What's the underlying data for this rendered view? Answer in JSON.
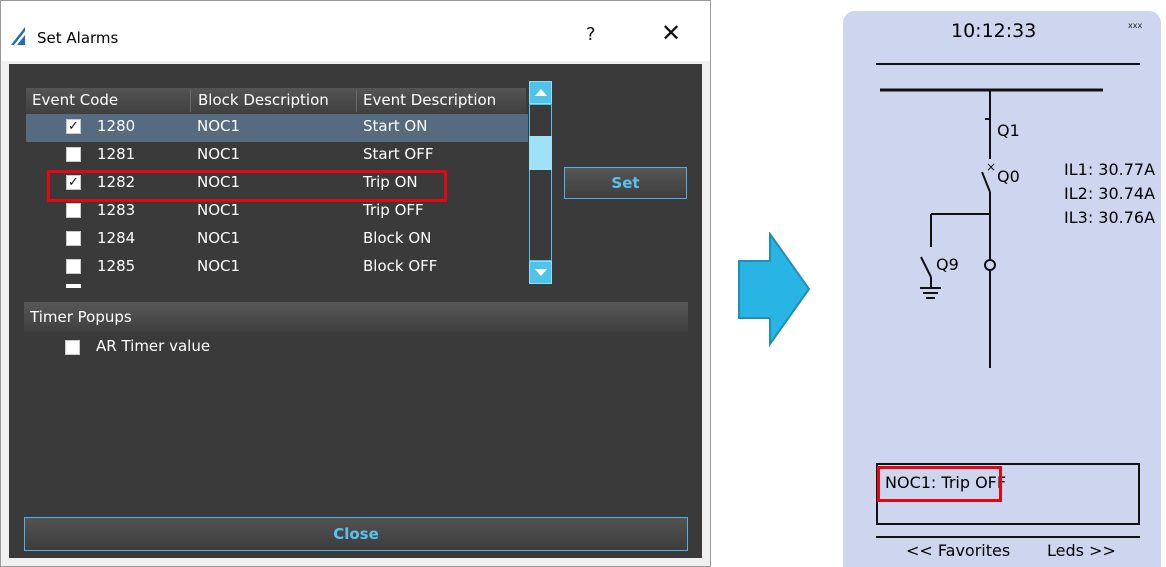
{
  "dialog": {
    "title": "Set Alarms",
    "help_label": "?",
    "close_glyph": "✕",
    "columns": [
      "Event Code",
      "Block Description",
      "Event Description"
    ],
    "rows": [
      {
        "checked": true,
        "code": "1280",
        "block": "NOC1",
        "event": "Start ON",
        "selected": true
      },
      {
        "checked": false,
        "code": "1281",
        "block": "NOC1",
        "event": "Start OFF",
        "selected": false
      },
      {
        "checked": true,
        "code": "1282",
        "block": "NOC1",
        "event": "Trip ON",
        "selected": false,
        "highlighted": true
      },
      {
        "checked": false,
        "code": "1283",
        "block": "NOC1",
        "event": "Trip OFF",
        "selected": false
      },
      {
        "checked": false,
        "code": "1284",
        "block": "NOC1",
        "event": "Block ON",
        "selected": false
      },
      {
        "checked": false,
        "code": "1285",
        "block": "NOC1",
        "event": "Block OFF",
        "selected": false
      }
    ],
    "set_button": "Set",
    "timer_section_title": "Timer Popups",
    "timer_option_label": "AR Timer value",
    "timer_option_checked": false,
    "close_button": "Close"
  },
  "device": {
    "time": "10:12:33",
    "corner_text": "xxx",
    "labels": {
      "q1": "Q1",
      "q0": "Q0",
      "q9": "Q9"
    },
    "measurements": [
      "IL1: 30.77A",
      "IL2: 30.74A",
      "IL3: 30.76A"
    ],
    "alarm_message": "NOC1: Trip OFF",
    "footer_left": "<< Favorites",
    "footer_right": "Leds >>"
  },
  "colors": {
    "accent": "#4fc3ea",
    "highlight": "#e30613",
    "dialog_bg": "#3a3a3a",
    "device_bg": "#cdd6ee"
  }
}
